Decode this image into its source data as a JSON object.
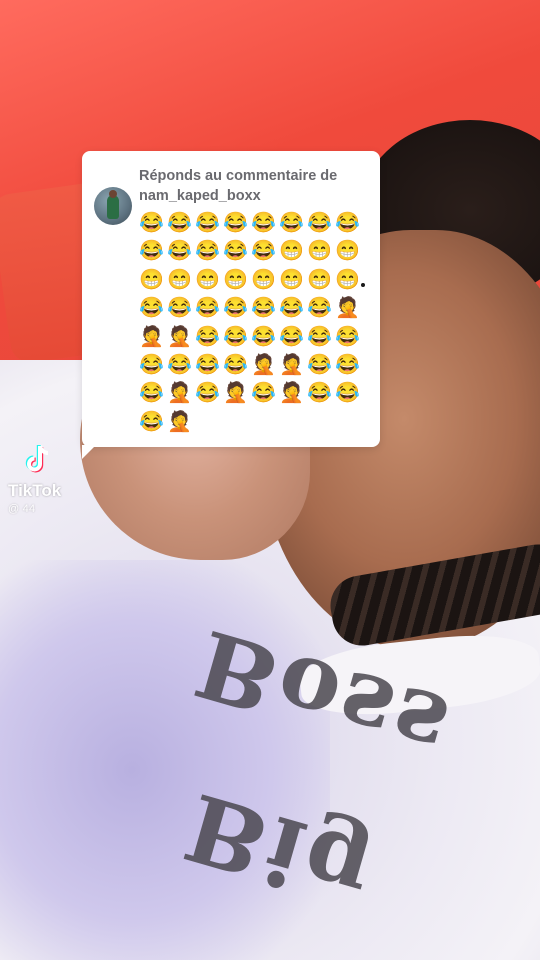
{
  "comment_card": {
    "header": "Réponds au commentaire de nam_kaped_boxx",
    "emojis": [
      "😂",
      "😂",
      "😂",
      "😂",
      "😂",
      "😂",
      "😂",
      "😂",
      "😂",
      "😂",
      "😂",
      "😂",
      "😂",
      "😁",
      "😁",
      "😁",
      "😁",
      "😁",
      "😁",
      "😁",
      "😁",
      "😁",
      "😁",
      "😁",
      "😂",
      "😂",
      "😂",
      "😂",
      "😂",
      "😂",
      "😂",
      "🤦",
      "🤦",
      "🤦",
      "😂",
      "😂",
      "😂",
      "😂",
      "😂",
      "😂",
      "😂",
      "😂",
      "😂",
      "😂",
      "🤦",
      "🤦",
      "😂",
      "😂",
      "😂",
      "🤦",
      "😂",
      "🤦",
      "😂",
      "🤦",
      "😂",
      "😂",
      "😂",
      "🤦"
    ]
  },
  "watermark": {
    "brand": "TikTok",
    "username": "@              44"
  },
  "background": {
    "shirt_print": "Big Boss"
  }
}
